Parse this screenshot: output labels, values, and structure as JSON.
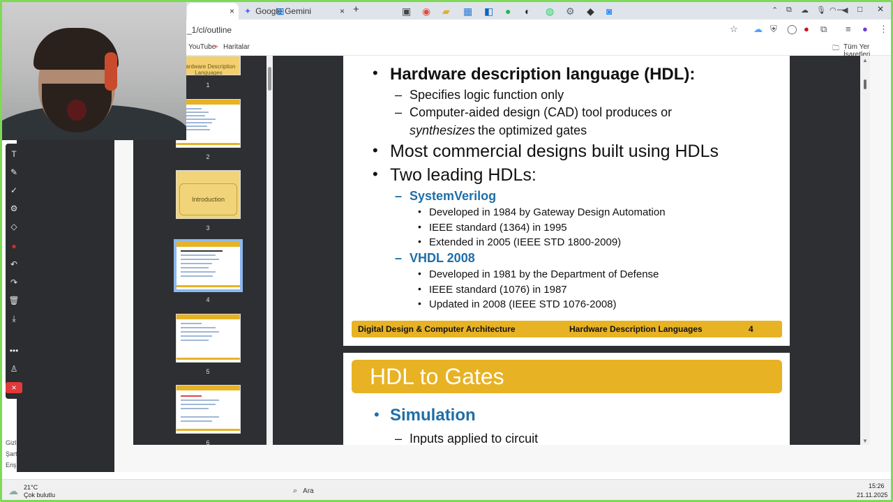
{
  "browser": {
    "tabs": [
      {
        "label": "",
        "close": "×"
      },
      {
        "label": "Google Gemini",
        "close": "×"
      }
    ],
    "new_tab": "+",
    "window_controls": [
      "—",
      "□",
      "✕"
    ],
    "url": "_1/cl/outline",
    "bookmarks": [
      {
        "label": "YouTube"
      },
      {
        "label": "Haritalar"
      }
    ],
    "all_bookmarks": "Tüm Yer İşaretleri"
  },
  "left_sidebar": {
    "texts": [
      "Gizl",
      "Şart",
      "Erişi"
    ]
  },
  "thumbnails": [
    {
      "num": "1",
      "title": "Hardware Description Languages"
    },
    {
      "num": "2"
    },
    {
      "num": "3",
      "title": "Introduction"
    },
    {
      "num": "4"
    },
    {
      "num": "5"
    },
    {
      "num": "6"
    }
  ],
  "slide4": {
    "b1": "Hardware description language (HDL):",
    "b1s1": "Specifies logic function only",
    "b1s2a": "Computer-aided design (CAD) tool produces or",
    "b1s2b_em": "synthesizes",
    "b1s2b": " the optimized gates",
    "b2": "Most commercial designs built using HDLs",
    "b3": "Two leading HDLs:",
    "sv": "SystemVerilog",
    "sv1": "Developed in 1984 by Gateway Design Automation",
    "sv2": "IEEE standard (1364) in 1995",
    "sv3": "Extended in 2005 (IEEE STD 1800-2009)",
    "vhdl": "VHDL 2008",
    "vh1": "Developed in 1981 by the Department of Defense",
    "vh2": "IEEE standard (1076) in 1987",
    "vh3": "Updated in 2008 (IEEE STD 1076-2008)",
    "footer_left": "Digital Design & Computer Architecture",
    "footer_mid": "Hardware Description Languages",
    "footer_num": "4"
  },
  "slide5": {
    "title": "HDL to Gates",
    "b1": "Simulation",
    "b1s1": "Inputs applied to circuit"
  },
  "taskbar": {
    "weather_temp": "21°C",
    "weather_desc": "Çok bulutlu",
    "search": "Ara",
    "time": "15:26",
    "date": "21.11.2025"
  }
}
